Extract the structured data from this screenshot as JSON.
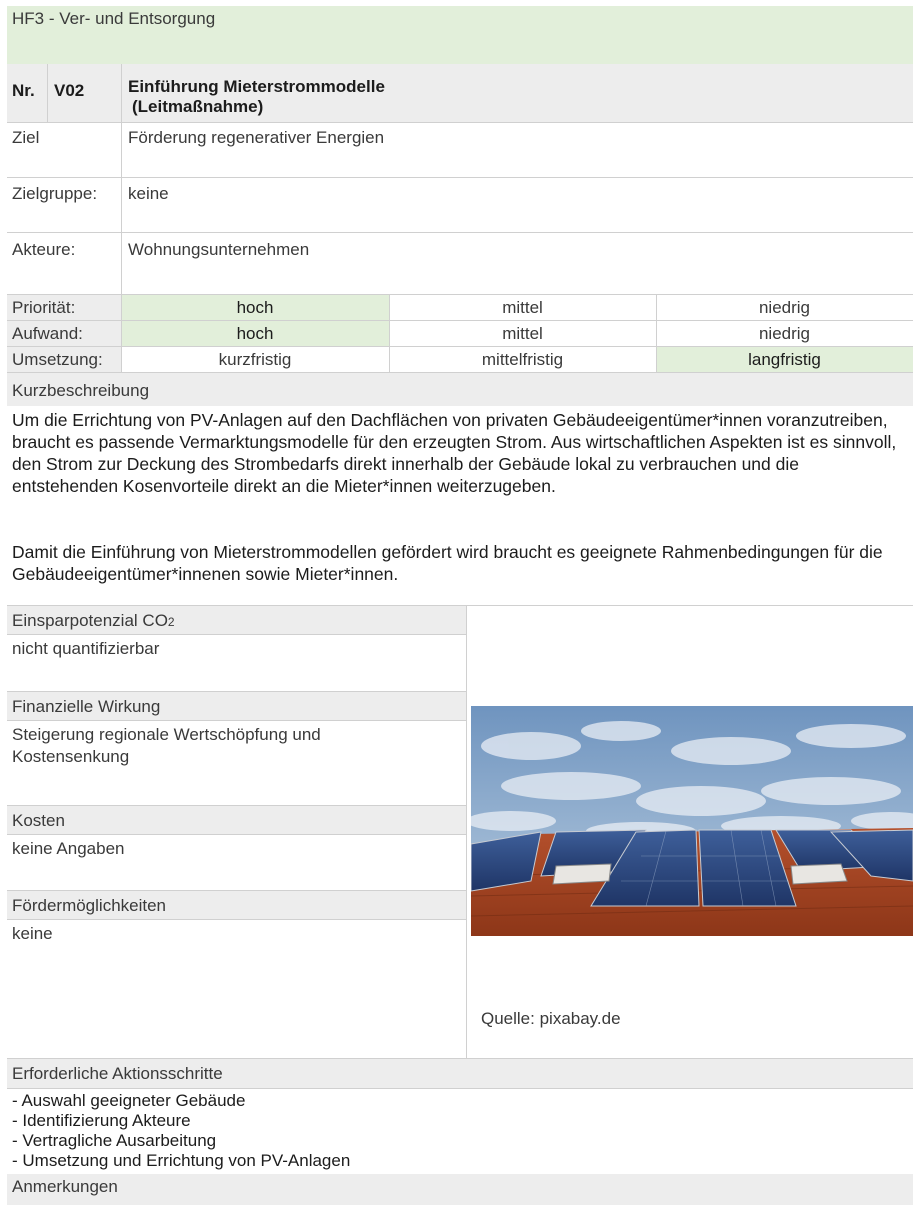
{
  "header": {
    "title": "HF3 - Ver- und Entsorgung"
  },
  "measure": {
    "nr_label": "Nr.",
    "nr_value": "V02",
    "title": "Einführung Mieterstrommodelle",
    "subtitle": "(Leitmaßnahme)"
  },
  "fields": {
    "ziel_label": "Ziel",
    "ziel_value": "Förderung regenerativer Energien",
    "zielgruppe_label": "Zielgruppe:",
    "zielgruppe_value": "keine",
    "akteure_label": "Akteure:",
    "akteure_value": "Wohnungsunternehmen"
  },
  "ratings": {
    "prioritaet_label": "Priorität:",
    "prioritaet_options": [
      "hoch",
      "mittel",
      "niedrig"
    ],
    "prioritaet_selected": "hoch",
    "aufwand_label": "Aufwand:",
    "aufwand_options": [
      "hoch",
      "mittel",
      "niedrig"
    ],
    "aufwand_selected": "hoch",
    "umsetzung_label": "Umsetzung:",
    "umsetzung_options": [
      "kurzfristig",
      "mittelfristig",
      "langfristig"
    ],
    "umsetzung_selected": "langfristig"
  },
  "description": {
    "label": "Kurzbeschreibung",
    "para1": "Um die Errichtung von PV-Anlagen auf den Dachflächen von privaten Gebäudeeigentümer*innen voranzutreiben, braucht es passende Vermarktungsmodelle für den erzeugten Strom. Aus wirtschaftlichen Aspekten ist es sinnvoll, den Strom zur Deckung des Strombedarfs direkt innerhalb der Gebäude lokal zu verbrauchen und die entstehenden Kosenvorteile direkt an die Mieter*innen weiterzugeben.",
    "para2": "Damit die Einführung von Mieterstrommodellen gefördert wird braucht es geeignete Rahmenbedingungen für die Gebäudeeigentümer*innenen sowie Mieter*innen."
  },
  "left_sections": {
    "co2_label": "Einsparpotenzial CO",
    "co2_sub": "2",
    "co2_value": "nicht quantifizierbar",
    "finanz_label": "Finanzielle Wirkung",
    "finanz_value": "Steigerung regionale Wertschöpfung und Kostensenkung",
    "kosten_label": "Kosten",
    "kosten_value": "keine Angaben",
    "foerder_label": "Fördermöglichkeiten",
    "foerder_value": "keine"
  },
  "image": {
    "source": "Quelle: pixabay.de"
  },
  "actions": {
    "label": "Erforderliche Aktionsschritte",
    "items": [
      "- Auswahl geeigneter Gebäude",
      "- Identifizierung Akteure",
      "- Vertragliche Ausarbeitung",
      "- Umsetzung und Errichtung von PV-Anlagen"
    ]
  },
  "remarks": {
    "label": "Anmerkungen"
  }
}
